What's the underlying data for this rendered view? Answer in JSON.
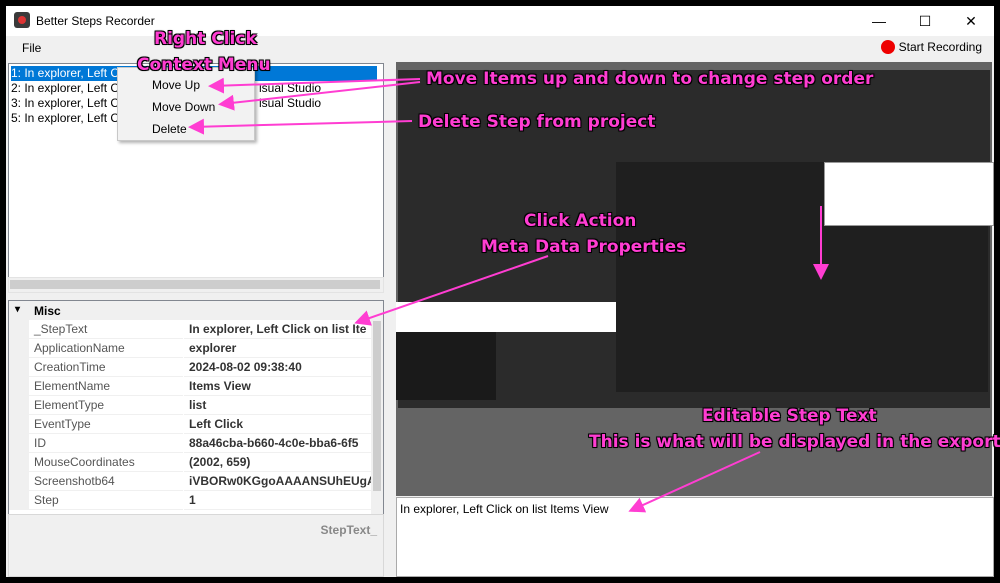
{
  "window": {
    "title": "Better Steps Recorder",
    "minimize_glyph": "—",
    "maximize_glyph": "☐",
    "close_glyph": "✕"
  },
  "menubar": {
    "file_label": "File",
    "record_label": "Start Recording"
  },
  "steps": [
    {
      "label": "1: In explorer, Left Cli"
    },
    {
      "label": "2: In explorer, Left C",
      "suffix": "isual Studio"
    },
    {
      "label": "3: In explorer, Left C",
      "suffix": "isual Studio"
    },
    {
      "label": "5: In explorer, Left C"
    }
  ],
  "context_menu": {
    "items": [
      {
        "label": "Move Up"
      },
      {
        "label": "Move Down"
      },
      {
        "label": "Delete"
      }
    ]
  },
  "properties": {
    "category": "Misc",
    "rows": [
      {
        "name": "_StepText",
        "value": "In explorer, Left Click on  list Ite"
      },
      {
        "name": "ApplicationName",
        "value": "explorer"
      },
      {
        "name": "CreationTime",
        "value": "2024-08-02 09:38:40"
      },
      {
        "name": "ElementName",
        "value": "Items View"
      },
      {
        "name": "ElementType",
        "value": "list"
      },
      {
        "name": "EventType",
        "value": "Left Click"
      },
      {
        "name": "ID",
        "value": "88a46cba-b660-4c0e-bba6-6f5"
      },
      {
        "name": "MouseCoordinates",
        "value": "(2002, 659)"
      },
      {
        "name": "Screenshotb64",
        "value": "iVBORw0KGgoAAAANSUhEUgA"
      },
      {
        "name": "Step",
        "value": "1"
      }
    ]
  },
  "description": {
    "label": "StepText_"
  },
  "editor": {
    "text": "In explorer, Left Click on  list Items View"
  },
  "annotations": {
    "right_click": "Right Click",
    "context_menu": "Context Menu",
    "move_items": "Move Items up and down to change step order",
    "delete_step": "Delete Step from project",
    "click_action": "Click Action",
    "meta_data": "Meta Data Properties",
    "editable": "Editable Step Text",
    "export": "This is what will be displayed in the export"
  },
  "colors": {
    "annotation": "#ff3dd2",
    "selection": "#0078d7",
    "record": "#e00000"
  }
}
